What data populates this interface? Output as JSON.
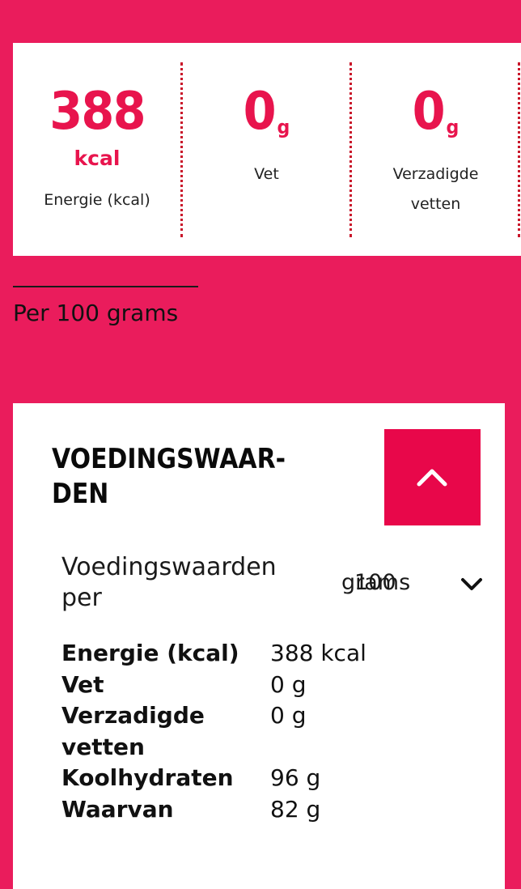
{
  "summary": {
    "energy": {
      "value": "388",
      "unit": "kcal",
      "label": "Energie (kcal)"
    },
    "fat": {
      "value": "0",
      "unit": "g",
      "label": "Vet"
    },
    "saturated": {
      "value": "0",
      "unit": "g",
      "label": "Verzadigde vetten"
    }
  },
  "per_text": "Per 100 grams",
  "panel": {
    "title": "VOEDINGSWAAR-DEN",
    "per_label": "Voedingswaarden per",
    "per_select": {
      "amount": "100",
      "unit": "grams"
    },
    "rows": [
      {
        "name": "Energie (kcal)",
        "value": "388 kcal"
      },
      {
        "name": "Vet",
        "value": "0 g"
      },
      {
        "name": "Verzadigde vetten",
        "value": "0 g"
      },
      {
        "name": "Koolhydraten",
        "value": "96 g"
      },
      {
        "name": "Waarvan",
        "value": "82 g"
      }
    ]
  },
  "colors": {
    "background": "#ea1c5c",
    "accent": "#e8144d",
    "button": "#e8074a"
  },
  "icons": {
    "toggle": "chevron-up-icon",
    "select": "chevron-down-icon"
  }
}
